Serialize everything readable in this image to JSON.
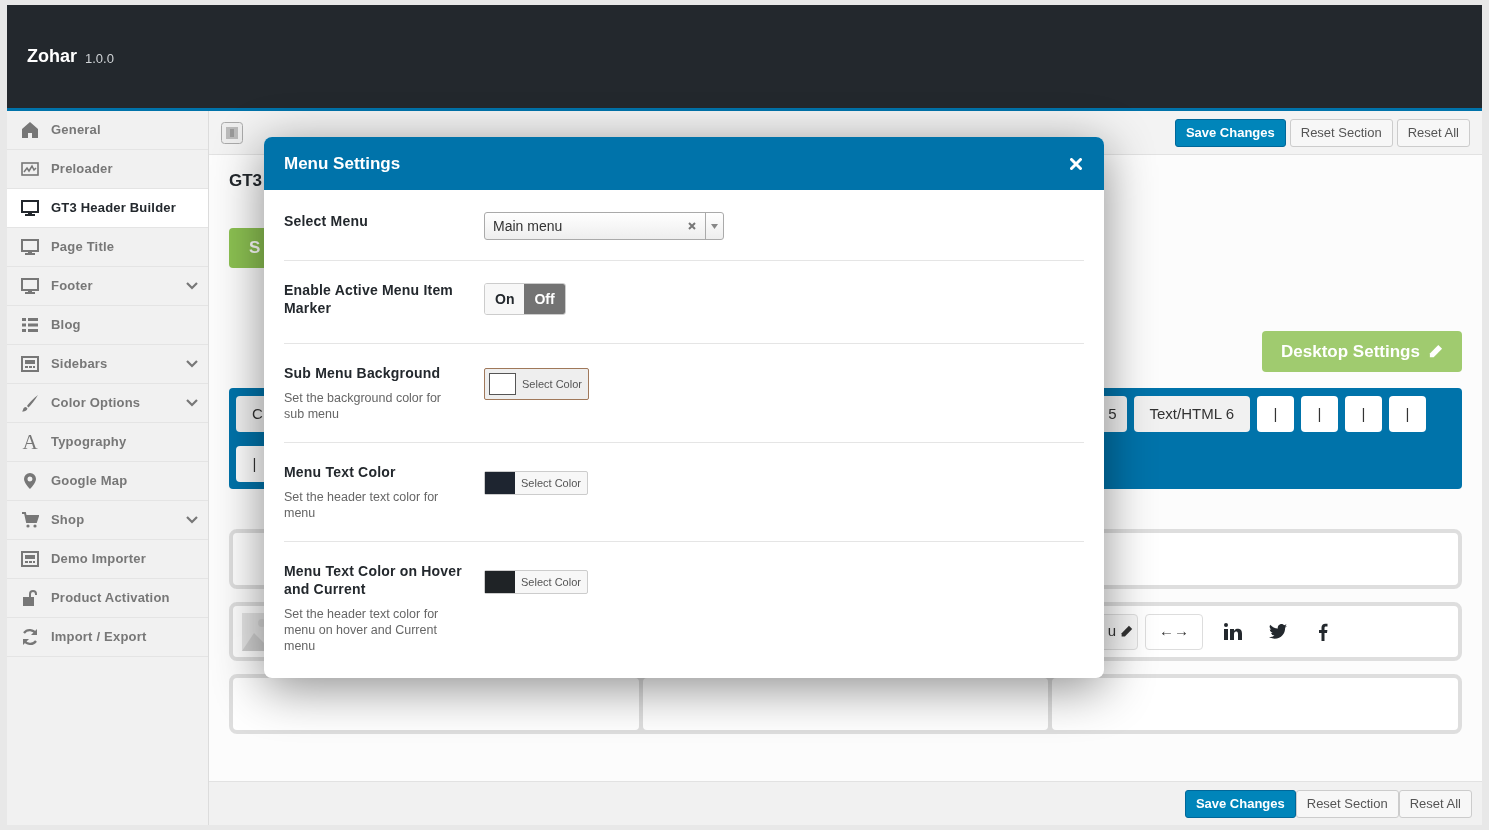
{
  "app": {
    "name": "Zohar",
    "version": "1.0.0"
  },
  "sidebar": {
    "items": [
      {
        "label": "General",
        "selected": false,
        "has_submenu": false
      },
      {
        "label": "Preloader",
        "selected": false,
        "has_submenu": false
      },
      {
        "label": "GT3 Header Builder",
        "selected": true,
        "has_submenu": false
      },
      {
        "label": "Page Title",
        "selected": false,
        "has_submenu": false
      },
      {
        "label": "Footer",
        "selected": false,
        "has_submenu": true
      },
      {
        "label": "Blog",
        "selected": false,
        "has_submenu": false
      },
      {
        "label": "Sidebars",
        "selected": false,
        "has_submenu": true
      },
      {
        "label": "Color Options",
        "selected": false,
        "has_submenu": true
      },
      {
        "label": "Typography",
        "selected": false,
        "has_submenu": false,
        "glyph": "A"
      },
      {
        "label": "Google Map",
        "selected": false,
        "has_submenu": false
      },
      {
        "label": "Shop",
        "selected": false,
        "has_submenu": true
      },
      {
        "label": "Demo Importer",
        "selected": false,
        "has_submenu": false
      },
      {
        "label": "Product Activation",
        "selected": false,
        "has_submenu": false
      },
      {
        "label": "Import / Export",
        "selected": false,
        "has_submenu": false
      }
    ]
  },
  "toolbar": {
    "buttons": [
      {
        "label": "Save Changes",
        "kind": "primary"
      },
      {
        "label": "Reset Section",
        "kind": "secondary"
      },
      {
        "label": "Reset All",
        "kind": "secondary"
      }
    ]
  },
  "builder": {
    "title": "GT3",
    "green_button": "S",
    "desktop_settings": "Desktop Settings",
    "row_1_left": [
      {
        "label": "C",
        "kind": "element"
      }
    ],
    "row_1_right": [
      {
        "label": "5",
        "kind": "element"
      },
      {
        "label": "Text/HTML 6",
        "kind": "element"
      },
      {
        "label": "|",
        "kind": "divider"
      },
      {
        "label": "|",
        "kind": "divider"
      },
      {
        "label": "|",
        "kind": "divider"
      },
      {
        "label": "|",
        "kind": "divider"
      }
    ],
    "row_2_left": [
      {
        "label": "|",
        "kind": "divider"
      }
    ],
    "middle_item": "u",
    "arrows_item": "←→"
  },
  "modal": {
    "title": "Menu Settings",
    "fields": [
      {
        "kind": "select",
        "label": "Select Menu",
        "value": "Main menu"
      },
      {
        "kind": "toggle",
        "label": "Enable Active Menu Item Marker",
        "options": [
          {
            "label": "On",
            "selected": false
          },
          {
            "label": "Off",
            "selected": true
          }
        ]
      },
      {
        "kind": "color",
        "label": "Sub Menu Background",
        "description": "Set the background color for sub menu",
        "button": "Select Color",
        "color": "#ffffff",
        "focused": true
      },
      {
        "kind": "color",
        "label": "Menu Text Color",
        "description": "Set the header text color for menu",
        "button": "Select Color",
        "color": "#1e2530",
        "focused": false
      },
      {
        "kind": "color",
        "label": "Menu Text Color on Hover and Current",
        "description": "Set the header text color for menu on hover and Current menu",
        "button": "Select Color",
        "color": "#1f2326",
        "focused": false
      }
    ]
  },
  "footer_buttons": [
    {
      "label": "Save Changes",
      "kind": "primary"
    },
    {
      "label": "Reset Section",
      "kind": "secondary"
    },
    {
      "label": "Reset All",
      "kind": "secondary"
    }
  ]
}
